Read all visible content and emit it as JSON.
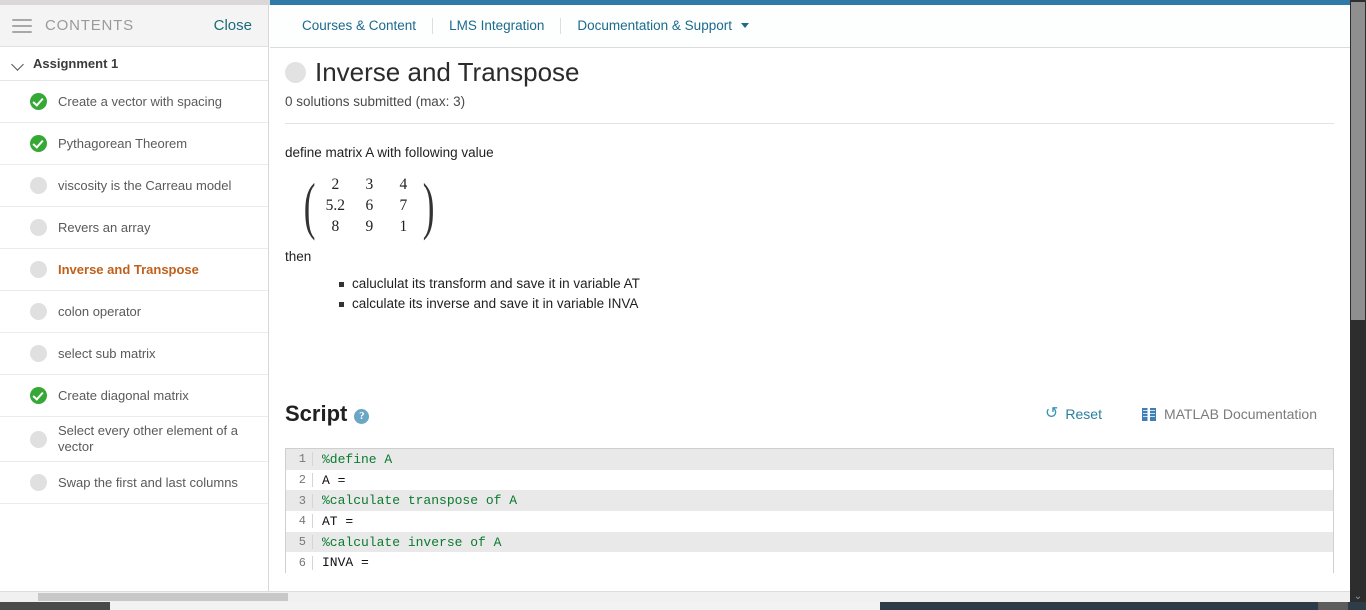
{
  "theme": {
    "accent_blue": "#2e7aa8",
    "link_blue": "#1c6a8e",
    "current_item_orange": "#c0601b",
    "done_green": "#36a836",
    "comment_green": "#0a7a2f"
  },
  "sidebar": {
    "header": {
      "menu_icon": "hamburger-icon",
      "title": "CONTENTS",
      "close_label": "Close"
    },
    "assignment": {
      "chevron_icon": "chevron-down-icon",
      "title": "Assignment 1"
    },
    "items": [
      {
        "label": "Create a vector with spacing",
        "status": "complete",
        "current": false
      },
      {
        "label": "Pythagorean Theorem",
        "status": "complete",
        "current": false
      },
      {
        "label": "viscosity is the Carreau model",
        "status": "incomplete",
        "current": false
      },
      {
        "label": "Revers an array",
        "status": "incomplete",
        "current": false
      },
      {
        "label": "Inverse and Transpose",
        "status": "incomplete",
        "current": true
      },
      {
        "label": "colon operator",
        "status": "incomplete",
        "current": false
      },
      {
        "label": "select sub matrix",
        "status": "incomplete",
        "current": false
      },
      {
        "label": "Create diagonal matrix",
        "status": "complete",
        "current": false
      },
      {
        "label": "Select every other element of a vector",
        "status": "incomplete",
        "current": false
      },
      {
        "label": "Swap the first and last columns",
        "status": "incomplete",
        "current": false
      }
    ]
  },
  "navbar": {
    "items": [
      {
        "label": "Courses & Content",
        "has_caret": false
      },
      {
        "label": "LMS Integration",
        "has_caret": false
      },
      {
        "label": "Documentation & Support",
        "has_caret": true
      }
    ],
    "caret_icon": "chevron-down-icon"
  },
  "problem": {
    "status_icon": "status-circle-icon",
    "title": "Inverse and Transpose",
    "submissions": "0 solutions submitted (max: 3)",
    "description": "define matrix A  with following value",
    "matrix": [
      [
        "2",
        "3",
        "4"
      ],
      [
        "5.2",
        "6",
        "7"
      ],
      [
        "8",
        "9",
        "1"
      ]
    ],
    "then_label": "then",
    "tasks": [
      "caluclulat  its transform and save it in variable AT",
      "calculate its inverse and save it in variable INVA"
    ]
  },
  "script": {
    "title": "Script",
    "help_icon": "help-circle-icon",
    "help_glyph": "?",
    "reset": {
      "label": "Reset",
      "icon": "refresh-icon",
      "glyph": "↻"
    },
    "documentation": {
      "label": "MATLAB Documentation",
      "icon": "book-icon"
    },
    "code_lines": [
      {
        "number": "1",
        "text": "%define A",
        "kind": "comment"
      },
      {
        "number": "2",
        "text": "A =",
        "kind": "code"
      },
      {
        "number": "3",
        "text": "%calculate transpose of A",
        "kind": "comment"
      },
      {
        "number": "4",
        "text": "AT =",
        "kind": "code"
      },
      {
        "number": "5",
        "text": "%calculate inverse of A",
        "kind": "comment"
      },
      {
        "number": "6",
        "text": "INVA =",
        "kind": "code"
      }
    ]
  },
  "scrollbars": {
    "vertical_arrow_glyph": "⌄"
  }
}
